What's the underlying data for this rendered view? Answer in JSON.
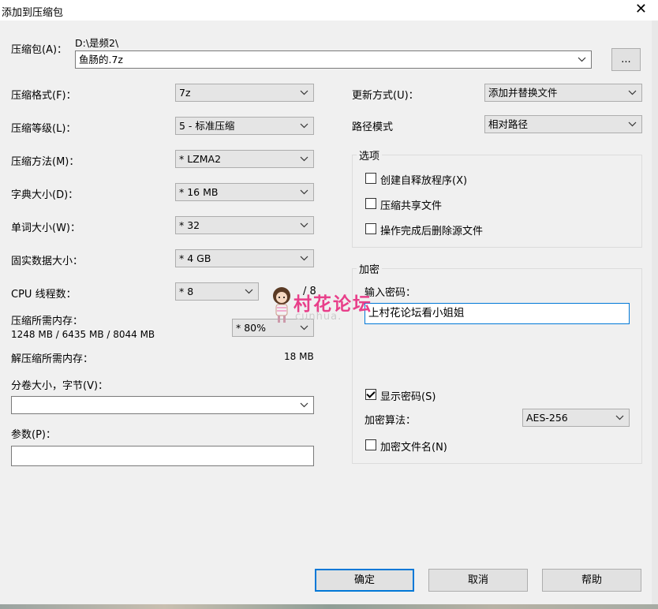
{
  "window": {
    "title": "添加到压缩包",
    "close_glyph": "✕"
  },
  "archive": {
    "label": "压缩包(A)：",
    "path": "D:\\是频2\\",
    "filename": "鱼肠的.7z",
    "browse_label": "..."
  },
  "left": {
    "format_label": "压缩格式(F)：",
    "format_value": "7z",
    "level_label": "压缩等级(L)：",
    "level_value": "5 - 标准压缩",
    "method_label": "压缩方法(M)：",
    "method_value": "* LZMA2",
    "dict_label": "字典大小(D)：",
    "dict_value": "* 16 MB",
    "word_label": "单词大小(W)：",
    "word_value": "* 32",
    "solid_label": "固实数据大小：",
    "solid_value": "* 4 GB",
    "cpu_label": "CPU 线程数：",
    "cpu_value": "* 8",
    "cpu_total": "/ 8",
    "mem_label": "压缩所需内存：",
    "mem_values": "1248 MB / 6435 MB / 8044 MB",
    "mem_percent": "* 80%",
    "decomp_label": "解压缩所需内存：",
    "decomp_value": "18 MB",
    "split_label": "分卷大小，字节(V)：",
    "split_value": "",
    "params_label": "参数(P)：",
    "params_value": ""
  },
  "right": {
    "update_label": "更新方式(U)：",
    "update_value": "添加并替换文件",
    "path_label": "路径模式",
    "path_value": "相对路径",
    "options_title": "选项",
    "opt_sfx": "创建自释放程序(X)",
    "opt_shared": "压缩共享文件",
    "opt_delete": "操作完成后删除源文件",
    "encrypt_title": "加密",
    "password_label": "输入密码：",
    "password_value": "上村花论坛看小姐姐",
    "show_password": "显示密码(S)",
    "algo_label": "加密算法：",
    "algo_value": "AES-256",
    "encrypt_names": "加密文件名(N)"
  },
  "watermark": {
    "text": "村花论坛",
    "sub": "cunhua."
  },
  "buttons": {
    "ok": "确定",
    "cancel": "取消",
    "help": "帮助"
  },
  "colors": {
    "accent": "#0078d7",
    "watermark": "#e83f8a"
  }
}
